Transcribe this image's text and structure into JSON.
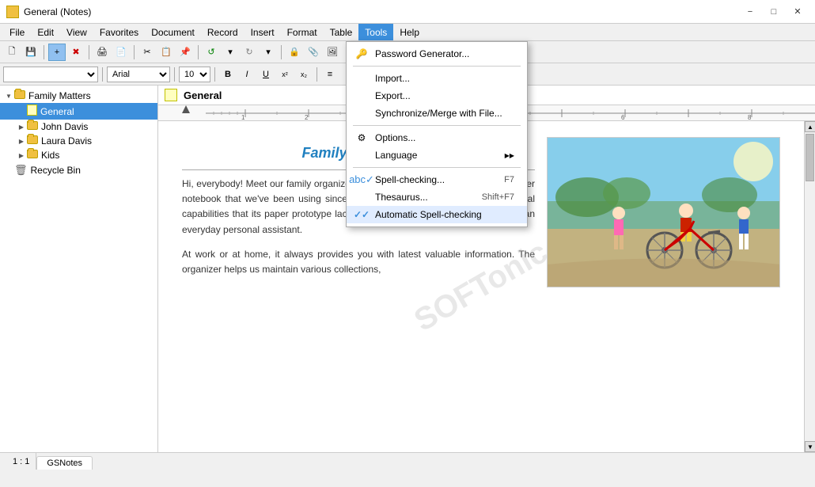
{
  "window": {
    "title": "General (Notes)",
    "min_btn": "−",
    "max_btn": "□",
    "close_btn": "✕"
  },
  "menubar": {
    "items": [
      "File",
      "Edit",
      "View",
      "Favorites",
      "Document",
      "Record",
      "Insert",
      "Format",
      "Table",
      "Tools",
      "Help"
    ]
  },
  "toolbar": {
    "dropdowns": {
      "style": "",
      "font": "Arial",
      "size": "10"
    }
  },
  "sidebar": {
    "items": [
      {
        "label": "Family Matters",
        "type": "folder",
        "level": 0,
        "expanded": true
      },
      {
        "label": "General",
        "type": "note",
        "level": 1,
        "selected": true
      },
      {
        "label": "John Davis",
        "type": "folder",
        "level": 1,
        "expanded": false
      },
      {
        "label": "Laura Davis",
        "type": "folder",
        "level": 1,
        "expanded": false
      },
      {
        "label": "Kids",
        "type": "folder",
        "level": 1,
        "expanded": false
      },
      {
        "label": "Recycle Bin",
        "type": "recycle",
        "level": 0,
        "expanded": false
      }
    ]
  },
  "note": {
    "title": "General",
    "heading": "Family organizer",
    "para1": "Hi, everybody! Meet our family organizer. For the most part, it is almost like a paper notebook that we've been using since childhood. But it also has some additional capabilities that its paper prototype lacks and that's why we started to use it as an everyday personal assistant.",
    "para2": "At work or at home, it always provides you with latest valuable information. The organizer helps us maintain various collections,"
  },
  "tools_menu": {
    "items": [
      {
        "id": "password_gen",
        "label": "Password Generator...",
        "shortcut": "",
        "icon": "key",
        "has_arrow": false,
        "checked": false,
        "separator_after": false
      },
      {
        "id": "sep1",
        "type": "separator"
      },
      {
        "id": "import",
        "label": "Import...",
        "shortcut": "",
        "icon": "",
        "has_arrow": false,
        "checked": false,
        "separator_after": false
      },
      {
        "id": "export",
        "label": "Export...",
        "shortcut": "",
        "icon": "",
        "has_arrow": false,
        "checked": false,
        "separator_after": false
      },
      {
        "id": "sync",
        "label": "Synchronize/Merge with File...",
        "shortcut": "",
        "icon": "",
        "has_arrow": false,
        "checked": false,
        "separator_after": true
      },
      {
        "id": "sep2",
        "type": "separator"
      },
      {
        "id": "options",
        "label": "Options...",
        "shortcut": "",
        "icon": "gear",
        "has_arrow": false,
        "checked": false,
        "separator_after": false
      },
      {
        "id": "language",
        "label": "Language",
        "shortcut": "",
        "icon": "",
        "has_arrow": true,
        "checked": false,
        "separator_after": true
      },
      {
        "id": "sep3",
        "type": "separator"
      },
      {
        "id": "spell",
        "label": "Spell-checking...",
        "shortcut": "F7",
        "icon": "spell",
        "has_arrow": false,
        "checked": false,
        "separator_after": false
      },
      {
        "id": "thesaurus",
        "label": "Thesaurus...",
        "shortcut": "Shift+F7",
        "icon": "",
        "has_arrow": false,
        "checked": false,
        "separator_after": false
      },
      {
        "id": "auto_spell",
        "label": "Automatic Spell-checking",
        "shortcut": "",
        "icon": "check",
        "has_arrow": false,
        "checked": true,
        "separator_after": false
      }
    ]
  },
  "statusbar": {
    "position": "1 : 1"
  },
  "tabs": [
    {
      "label": "GSNotes"
    }
  ]
}
